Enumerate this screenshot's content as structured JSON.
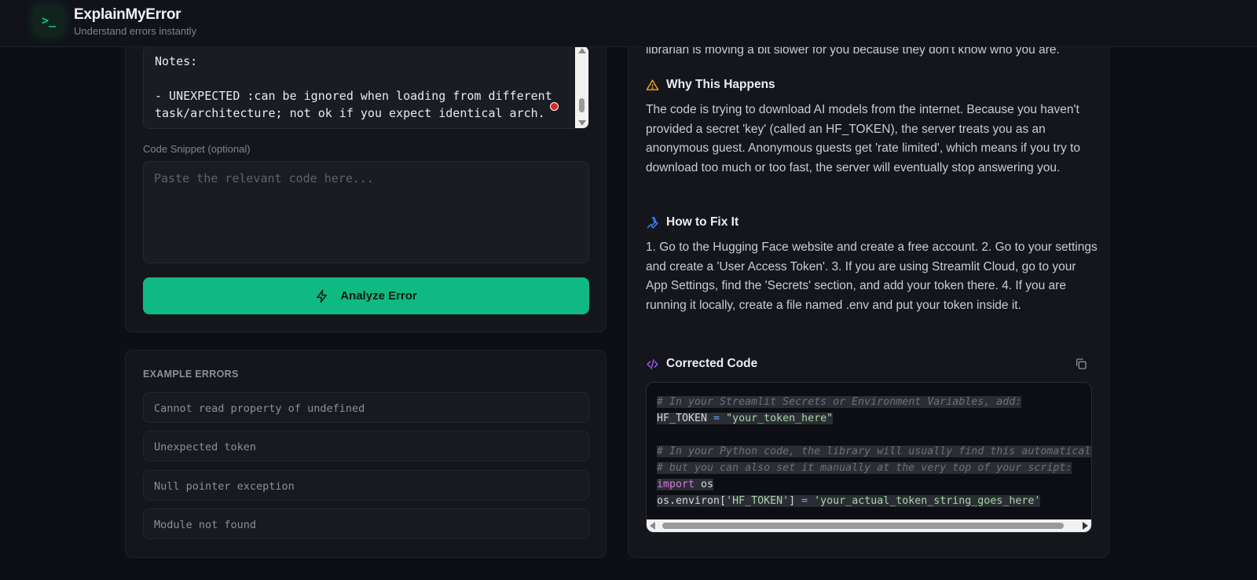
{
  "header": {
    "logo_glyph": ">_",
    "title": "ExplainMyError",
    "subtitle": "Understand errors instantly"
  },
  "input_panel": {
    "error_text": "Notes:\n\n- UNEXPECTED :can be ignored when loading from different\ntask/architecture; not ok if you expect identical arch.",
    "code_label": "Code Snippet (optional)",
    "code_placeholder": "Paste the relevant code here...",
    "analyze_label": "Analyze Error"
  },
  "examples": {
    "title": "EXAMPLE ERRORS",
    "items": [
      "Cannot read property of undefined",
      "Unexpected token",
      "Null pointer exception",
      "Module not found"
    ]
  },
  "result": {
    "intro_tail": "librarian is moving a bit slower for you because they don't know who you are.",
    "why_title": "Why This Happens",
    "why_text": "The code is trying to download AI models from the internet. Because you haven't provided a secret 'key' (called an HF_TOKEN), the server treats you as an anonymous guest. Anonymous guests get 'rate limited', which means if you try to download too much or too fast, the server will eventually stop answering you.",
    "fix_title": "How to Fix It",
    "fix_text": "1. Go to the Hugging Face website and create a free account. 2. Go to your settings and create a 'User Access Token'. 3. If you are using Streamlit Cloud, go to your App Settings, find the 'Secrets' section, and add your token there. 4. If you are running it locally, create a file named .env and put your token inside it.",
    "code_title": "Corrected Code",
    "code": {
      "l1": "# In your Streamlit Secrets or Environment Variables, add:",
      "l2_var": "HF_TOKEN",
      "l2_op": " = ",
      "l2_str": "\"your_token_here\"",
      "l4": "# In your Python code, the library will usually find this automatically,",
      "l5": "# but you can also set it manually at the very top of your script:",
      "l6_kw": "import",
      "l6_mod": " os",
      "l7_a": "os.environ[",
      "l7_key": "'HF_TOKEN'",
      "l7_b": "] ",
      "l7_op": "=",
      "l7_val": " 'your_actual_token_string_goes_here'"
    }
  },
  "colors": {
    "accent": "#10b981",
    "warning": "#f5a524",
    "wrench": "#3b82f6",
    "code_icon": "#a855f7"
  }
}
